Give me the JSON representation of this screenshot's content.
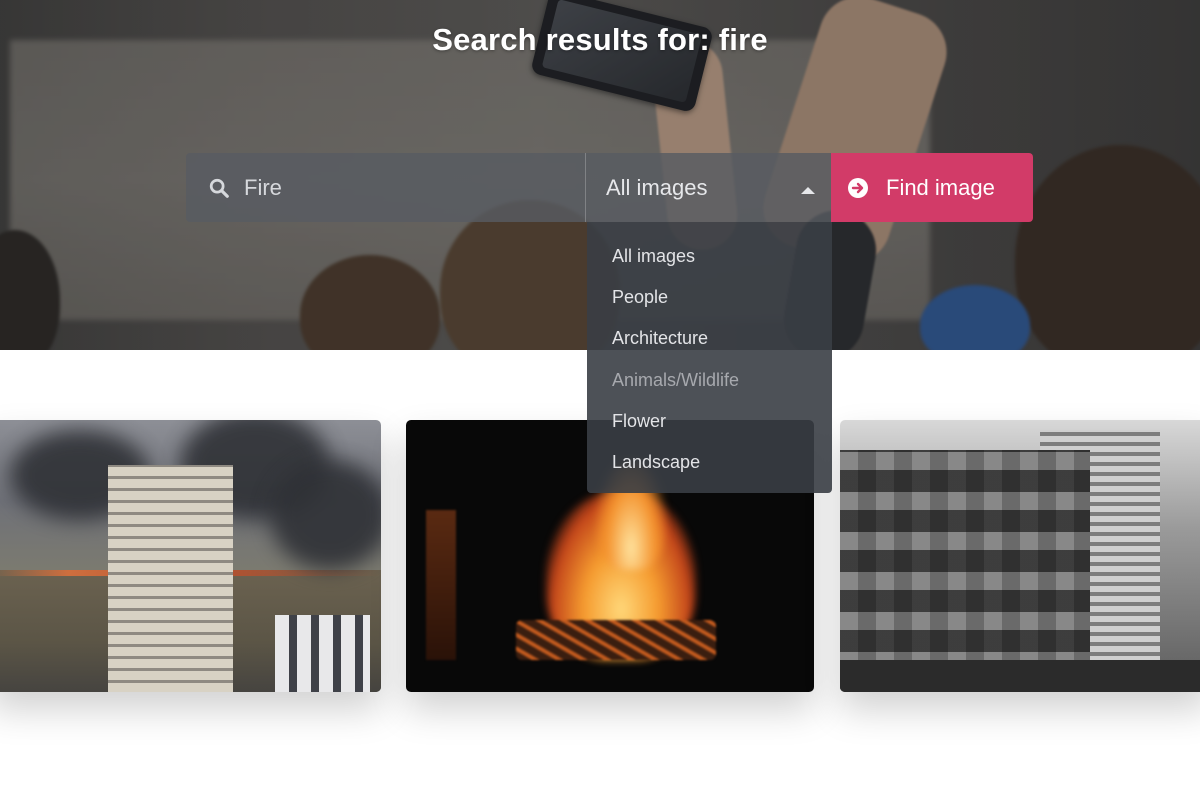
{
  "hero": {
    "title": "Search results for: fire"
  },
  "search": {
    "query": "Fire",
    "icon": "search-icon",
    "category_selected": "All images",
    "button_label": "Find image",
    "button_icon": "arrow-circle-right-icon",
    "button_color": "#d23b68"
  },
  "dropdown": {
    "options": [
      {
        "label": "All images"
      },
      {
        "label": "People"
      },
      {
        "label": "Architecture"
      },
      {
        "label": "Animals/Wildlife"
      },
      {
        "label": "Flower"
      },
      {
        "label": "Landscape"
      }
    ]
  },
  "gallery": {
    "images": [
      {
        "subject": "burning-field-with-high-rise-building"
      },
      {
        "subject": "bonfire-at-night"
      },
      {
        "subject": "black-and-white-city-buildings"
      }
    ]
  }
}
